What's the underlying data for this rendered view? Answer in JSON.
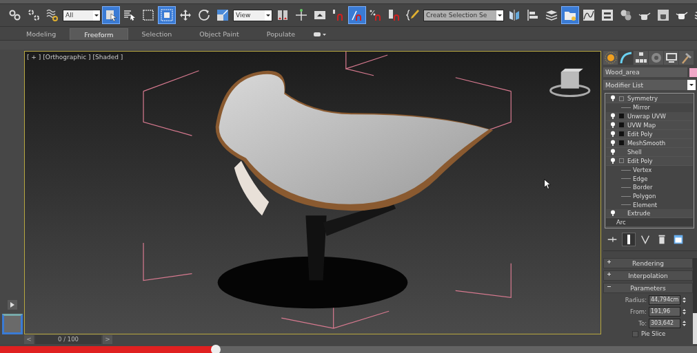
{
  "toolbar": [
    {
      "kind": "link",
      "selected": false
    },
    {
      "kind": "unlink",
      "selected": false
    },
    {
      "kind": "bind",
      "selected": false
    },
    {
      "kind": "dropdown",
      "value": "All"
    },
    {
      "kind": "select",
      "selected": true
    },
    {
      "kind": "select-by-name",
      "selected": false
    },
    {
      "kind": "region",
      "selected": false
    },
    {
      "kind": "window",
      "selected": true
    },
    {
      "kind": "move",
      "selected": false
    },
    {
      "kind": "rotate",
      "selected": false
    },
    {
      "kind": "scale",
      "selected": false
    },
    {
      "kind": "dropdown",
      "value": "View"
    },
    {
      "kind": "pivot",
      "selected": false
    },
    {
      "kind": "manipulate",
      "selected": false
    },
    {
      "kind": "keyboard",
      "selected": false
    },
    {
      "kind": "snap",
      "selected": false
    },
    {
      "kind": "angle-snap",
      "selected": true
    },
    {
      "kind": "percent-snap",
      "selected": false
    },
    {
      "kind": "spinner-snap",
      "selected": false
    },
    {
      "kind": "edit-named",
      "selected": false
    },
    {
      "kind": "dropdown",
      "value": "Create Selection Se"
    },
    {
      "kind": "mirror",
      "selected": false
    },
    {
      "kind": "align",
      "selected": false
    },
    {
      "kind": "layers",
      "selected": false
    },
    {
      "kind": "explorer",
      "selected": true
    },
    {
      "kind": "curve-editor",
      "selected": false
    },
    {
      "kind": "schematic",
      "selected": false
    },
    {
      "kind": "material",
      "selected": false
    },
    {
      "kind": "render-setup",
      "selected": false
    },
    {
      "kind": "render-frame",
      "selected": false
    },
    {
      "kind": "render",
      "selected": false
    },
    {
      "kind": "layers",
      "selected": false
    }
  ],
  "ribbon_tabs": [
    {
      "label": "Modeling",
      "selected": false
    },
    {
      "label": "Freeform",
      "selected": true
    },
    {
      "label": "Selection",
      "selected": false
    },
    {
      "label": "Object Paint",
      "selected": false
    },
    {
      "label": "Populate",
      "selected": false
    }
  ],
  "viewport": {
    "labels": [
      "[ + ]",
      "[Orthographic ]",
      "[Shaded ]"
    ]
  },
  "timeline": {
    "prev": "<",
    "position": "0 / 100",
    "next": ">",
    "level": 0
  },
  "command_panel": {
    "tabs": [
      {
        "kind": "create",
        "selected": false
      },
      {
        "kind": "modify",
        "selected": true
      },
      {
        "kind": "hierarchy",
        "selected": false
      },
      {
        "kind": "motion",
        "selected": false
      },
      {
        "kind": "display",
        "selected": false
      },
      {
        "kind": "utilities",
        "selected": false
      }
    ],
    "object_name": "Wood_area",
    "modifier_list": "Modifier List",
    "stack": [
      {
        "label": "Symmetry",
        "kind": "modifier",
        "expanded": true,
        "children": [
          {
            "label": "Mirror"
          }
        ]
      },
      {
        "label": "Unwrap UVW",
        "kind": "modifier",
        "expanded": false
      },
      {
        "label": "UVW Map",
        "kind": "modifier",
        "expanded": false
      },
      {
        "label": "Edit Poly",
        "kind": "modifier",
        "expanded": false
      },
      {
        "label": "MeshSmooth",
        "kind": "modifier",
        "expanded": false
      },
      {
        "label": "Shell",
        "kind": "plain"
      },
      {
        "label": "Edit Poly",
        "kind": "modifier",
        "expanded": true,
        "children": [
          {
            "label": "Vertex"
          },
          {
            "label": "Edge"
          },
          {
            "label": "Border"
          },
          {
            "label": "Polygon"
          },
          {
            "label": "Element"
          }
        ]
      },
      {
        "label": "Extrude",
        "kind": "plain"
      },
      {
        "label": "Arc",
        "kind": "base"
      }
    ],
    "stack_tools": [
      {
        "kind": "pin",
        "selected": false
      },
      {
        "kind": "end-result",
        "selected": true
      },
      {
        "kind": "make-unique",
        "selected": false
      },
      {
        "kind": "remove",
        "selected": false
      },
      {
        "kind": "configure",
        "selected": false
      }
    ],
    "rollouts": [
      {
        "label": "Rendering",
        "expanded": false
      },
      {
        "label": "Interpolation",
        "expanded": false
      },
      {
        "label": "Parameters",
        "expanded": true
      }
    ],
    "parameters": [
      {
        "label": "Radius:",
        "value": "44,794cm"
      },
      {
        "label": "From:",
        "value": "191,96"
      },
      {
        "label": "To:",
        "value": "303,642"
      }
    ],
    "pie_slice": {
      "label": "Pie Slice",
      "checked": false
    }
  },
  "video_progress": {
    "level": 0.31
  }
}
